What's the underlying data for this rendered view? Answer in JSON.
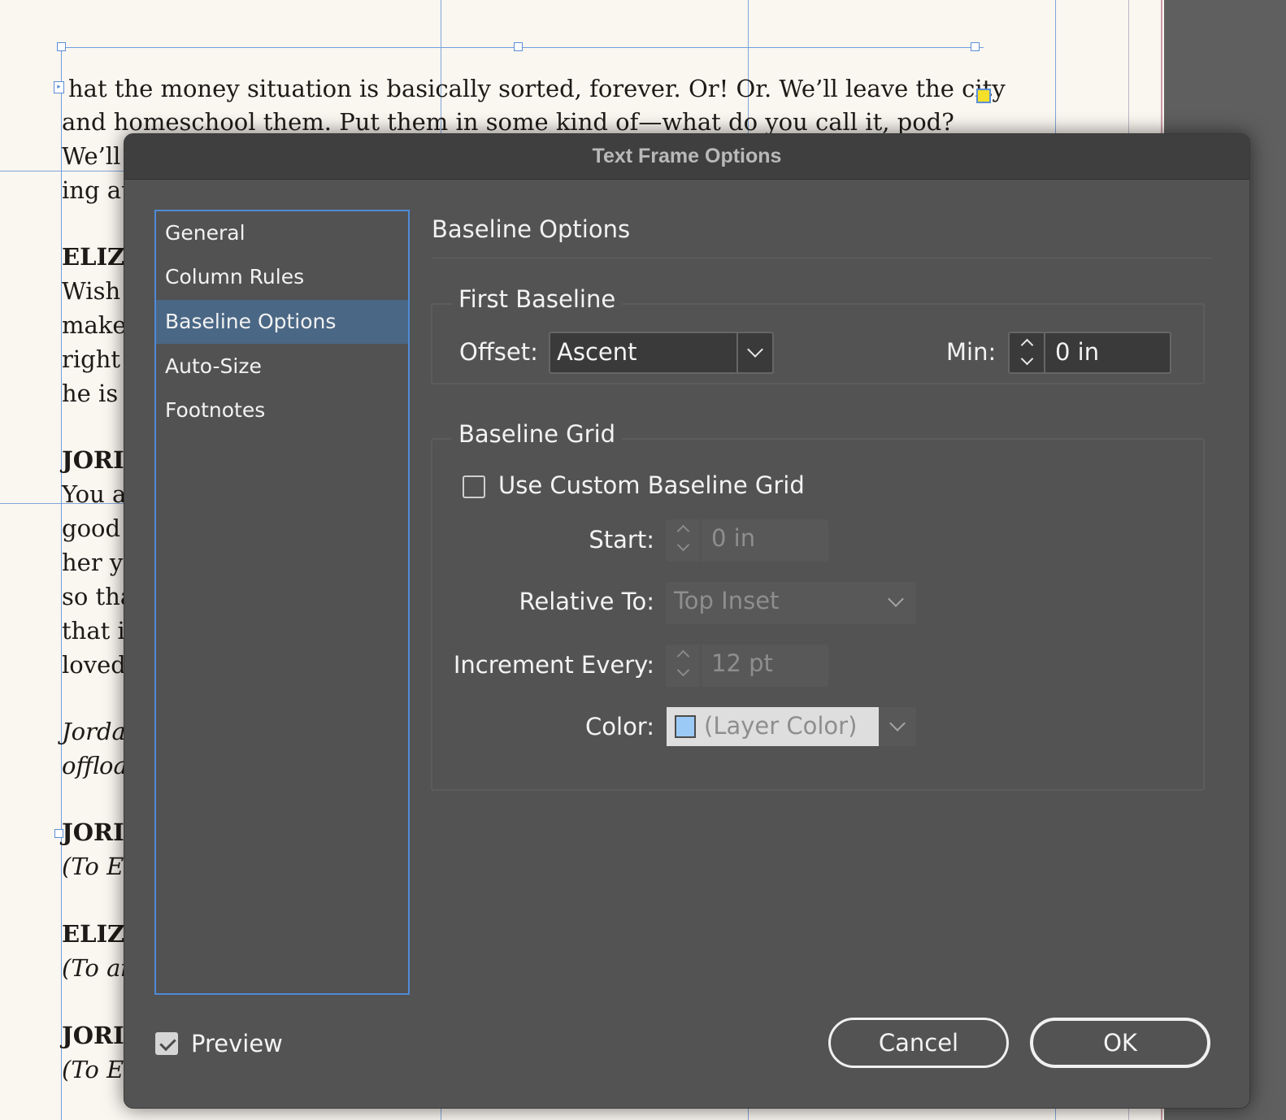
{
  "document": {
    "lines": [
      {
        "text": "hat the money situation is basically sorted, forever. Or! Or. We’ll leave the city",
        "style": "normal"
      },
      {
        "text": "and homeschool them. Put them in some kind of—what do you call it, pod?",
        "style": "normal"
      },
      {
        "text": "We’ll",
        "style": "normal"
      },
      {
        "text": "ing at",
        "style": "normal"
      },
      {
        "text": "ELIZ",
        "style": "bold"
      },
      {
        "text": "Wish",
        "style": "normal"
      },
      {
        "text": "make",
        "style": "normal"
      },
      {
        "text": "right",
        "style": "normal"
      },
      {
        "text": "he is",
        "style": "normal"
      },
      {
        "text": "JORI",
        "style": "bold"
      },
      {
        "text": "You a",
        "style": "normal"
      },
      {
        "text": "good",
        "style": "normal"
      },
      {
        "text": "her y",
        "style": "normal"
      },
      {
        "text": "so tha",
        "style": "normal"
      },
      {
        "text": "that i",
        "style": "normal"
      },
      {
        "text": "loved",
        "style": "normal"
      },
      {
        "text": "Jorda",
        "style": "italic"
      },
      {
        "text": "offloa",
        "style": "italic"
      },
      {
        "text": "JORI",
        "style": "bold"
      },
      {
        "text": "(To E",
        "style": "italic"
      },
      {
        "text": "ELIZ",
        "style": "bold"
      },
      {
        "text": "(To ai",
        "style": "italic"
      },
      {
        "text": "JORI",
        "style": "bold"
      },
      {
        "text": "(To E",
        "style": "italic"
      }
    ]
  },
  "dialog": {
    "title": "Text Frame Options",
    "sidebar": {
      "items": [
        {
          "label": "General",
          "selected": false
        },
        {
          "label": "Column Rules",
          "selected": false
        },
        {
          "label": "Baseline Options",
          "selected": true
        },
        {
          "label": "Auto-Size",
          "selected": false
        },
        {
          "label": "Footnotes",
          "selected": false
        }
      ]
    },
    "section_title": "Baseline Options",
    "first_baseline": {
      "legend": "First Baseline",
      "offset_label": "Offset:",
      "offset_value": "Ascent",
      "min_label": "Min:",
      "min_value": "0 in"
    },
    "baseline_grid": {
      "legend": "Baseline Grid",
      "use_custom_label": "Use Custom Baseline Grid",
      "use_custom_checked": false,
      "start_label": "Start:",
      "start_value": "0 in",
      "relative_to_label": "Relative To:",
      "relative_to_value": "Top Inset",
      "increment_label": "Increment Every:",
      "increment_value": "12 pt",
      "color_label": "Color:",
      "color_value": "(Layer Color)",
      "color_swatch": "#9ccaf6"
    },
    "preview": {
      "label": "Preview",
      "checked": true
    },
    "buttons": {
      "cancel": "Cancel",
      "ok": "OK"
    }
  },
  "icons": [
    "chevron-down-icon",
    "stepper-arrows-icon",
    "checkmark-icon",
    "color-swatch-icon"
  ],
  "colors": {
    "dialog_bg": "#535353",
    "titlebar_bg": "#3f3f3f",
    "selection": "#4a6785",
    "focus_ring": "#4f8bd6",
    "page_bg": "#faf6f0",
    "pasteboard": "#5f5f5f"
  }
}
